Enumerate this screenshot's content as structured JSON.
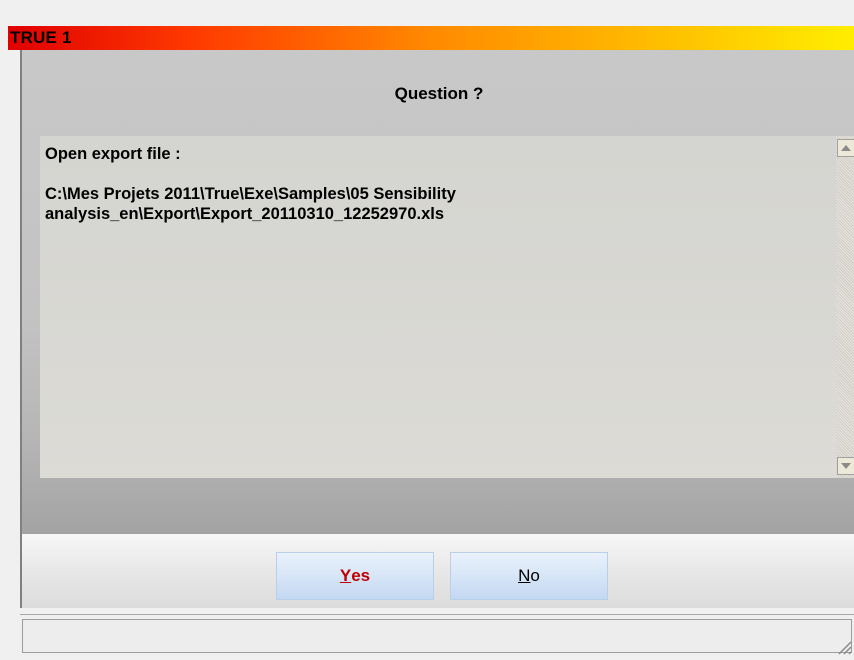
{
  "window": {
    "title": "TRUE 1"
  },
  "dialog": {
    "heading": "Question ?",
    "message_line1": "Open export file :",
    "message_line2": "C:\\Mes Projets 2011\\True\\Exe\\Samples\\05 Sensibility",
    "message_line3": "analysis_en\\Export\\Export_20110310_12252970.xls"
  },
  "buttons": {
    "yes_underline": "Y",
    "yes_rest": "es",
    "no_underline": "N",
    "no_rest": "o"
  },
  "icons": {
    "scroll_up": "scroll-up-arrow-icon",
    "scroll_down": "scroll-down-arrow-icon",
    "resize_grip": "resize-grip-icon"
  },
  "colors": {
    "title_gradient_start": "#e00000",
    "title_gradient_end": "#ffee00",
    "yes_text": "#c00000",
    "button_fill": "#d7e6f7"
  }
}
